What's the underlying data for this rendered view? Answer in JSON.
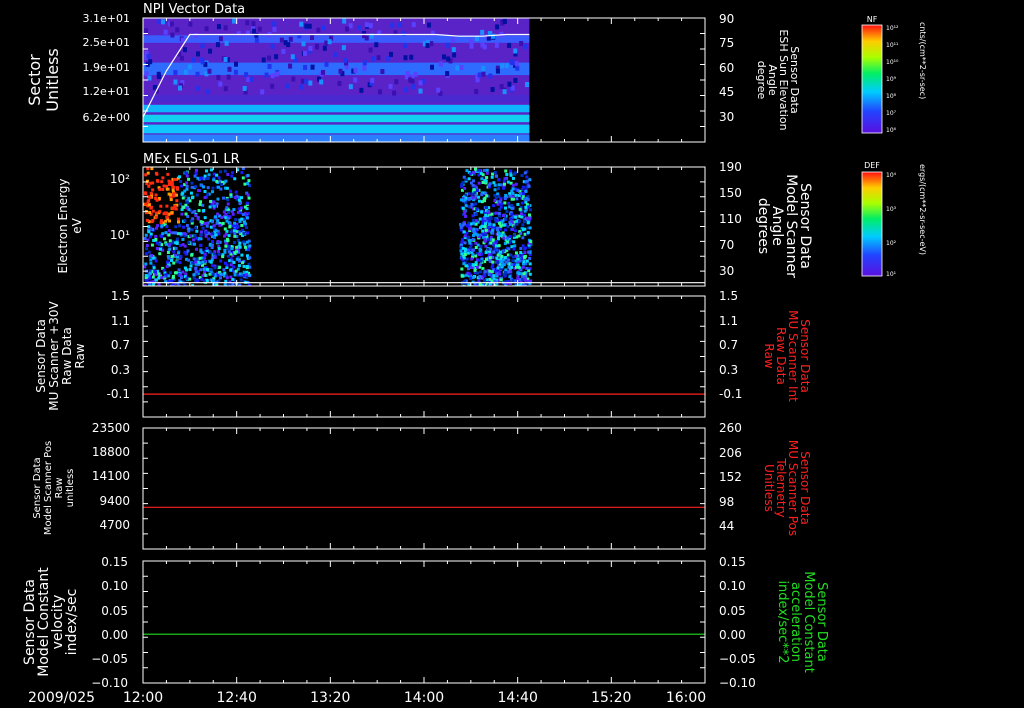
{
  "figure": {
    "date_label": "2009/025",
    "x_ticks": [
      "12:00",
      "12:40",
      "13:20",
      "14:00",
      "14:40",
      "15:20",
      "16:00"
    ],
    "x_range_hours": [
      12.0,
      16.0
    ]
  },
  "colors": {
    "background": "#000000",
    "frame": "#ffffff",
    "red_series": "#ff2020",
    "green_series": "#22dd22",
    "spectrogram_base": "#5a23c8"
  },
  "chart_data": [
    {
      "type": "heatmap",
      "title": "NPI Vector Data",
      "ylabel": [
        "Sector",
        "Unitless"
      ],
      "y_ticks": [
        "3.1e+01",
        "2.5e+01",
        "1.9e+01",
        "1.2e+01",
        "6.2e+00"
      ],
      "data_time_range": [
        "12:00",
        "14:45"
      ],
      "right_axis": {
        "label": [
          "Sensor Data",
          "ESH Sun Elevation",
          "Angle",
          "degree"
        ],
        "ticks": [
          90,
          75,
          60,
          45,
          30
        ],
        "range": [
          15,
          90
        ]
      },
      "overlay_line": {
        "x": [
          "12:00",
          "12:10",
          "12:20",
          "12:25",
          "14:00",
          "14:05",
          "14:15",
          "14:25",
          "14:35",
          "14:45"
        ],
        "y": [
          30,
          58,
          80,
          80,
          80,
          80,
          79,
          79,
          80,
          80
        ]
      },
      "colorbar": {
        "label": "NF",
        "units": "cnts/(cm**2-sr-sec)",
        "ticks": [
          "10¹²",
          "10¹¹",
          "10¹⁰",
          "10⁹",
          "10⁸",
          "10⁷",
          "10⁶"
        ]
      }
    },
    {
      "type": "heatmap",
      "title": "MEx ELS-01 LR",
      "ylabel": [
        "Electron Energy",
        "eV"
      ],
      "y_ticks": [
        "10²",
        "10¹"
      ],
      "data_time_ranges": [
        [
          "12:00",
          "12:45"
        ],
        [
          "14:15",
          "14:45"
        ]
      ],
      "right_axis": {
        "label": [
          "Sensor Data",
          "Model Scanner",
          "Angle",
          "degrees"
        ],
        "ticks": [
          190,
          150,
          110,
          70,
          30
        ],
        "range": [
          10,
          190
        ]
      },
      "overlay_line": {
        "x": [
          "12:00",
          "16:00"
        ],
        "y": [
          15,
          15
        ]
      },
      "colorbar": {
        "label": "DEF",
        "units": "ergs/(cm**2-sr-sec-eV)",
        "ticks": [
          "10⁴",
          "10³",
          "10²",
          "10¹"
        ]
      }
    },
    {
      "type": "line",
      "ylabel": [
        "Sensor Data",
        "MU Scanner +30V",
        "Raw Data",
        "Raw"
      ],
      "y_ticks": [
        1.5,
        1.1,
        0.7,
        0.3,
        -0.1
      ],
      "ylim": [
        -0.35,
        1.5
      ],
      "right_axis": {
        "label": [
          "Sensor Data",
          "MU Scanner Int",
          "Raw Data",
          "Raw"
        ],
        "ticks": [
          1.5,
          1.1,
          0.7,
          0.3,
          -0.1
        ],
        "range": [
          -0.35,
          1.5
        ]
      },
      "series": [
        {
          "color": "red",
          "x": [
            "12:00",
            "16:00"
          ],
          "y": [
            0.0,
            0.0
          ]
        }
      ]
    },
    {
      "type": "line",
      "ylabel": [
        "Sensor Data",
        "Model Scanner Pos",
        "Raw",
        "unitless"
      ],
      "y_ticks": [
        23500,
        18800,
        14100,
        9400,
        4700
      ],
      "ylim": [
        0,
        23500
      ],
      "right_axis": {
        "label": [
          "Sensor Data",
          "MU Scanner Pos",
          "Telemetry",
          "Unitless"
        ],
        "ticks": [
          260,
          206,
          152,
          98,
          44
        ],
        "range": [
          0,
          260
        ]
      },
      "series": [
        {
          "color": "red",
          "x": [
            "12:00",
            "16:00"
          ],
          "y": [
            8100,
            8100
          ]
        }
      ]
    },
    {
      "type": "line",
      "ylabel": [
        "Sensor Data",
        "Model Constant",
        "velocity",
        "index/sec"
      ],
      "y_ticks": [
        "0.15",
        "0.10",
        "0.05",
        "0.00",
        "−0.05",
        "−0.10"
      ],
      "ylim": [
        -0.1,
        0.15
      ],
      "right_axis": {
        "label": [
          "Sensor Data",
          "Model Constant",
          "acceleration",
          "index/sec**2"
        ],
        "ticks": [
          "0.15",
          "0.10",
          "0.05",
          "0.00",
          "−0.05",
          "−0.10"
        ],
        "range": [
          -0.1,
          0.15
        ]
      },
      "series": [
        {
          "color": "green",
          "x": [
            "12:00",
            "16:00"
          ],
          "y": [
            0.0,
            0.0
          ]
        }
      ]
    }
  ]
}
